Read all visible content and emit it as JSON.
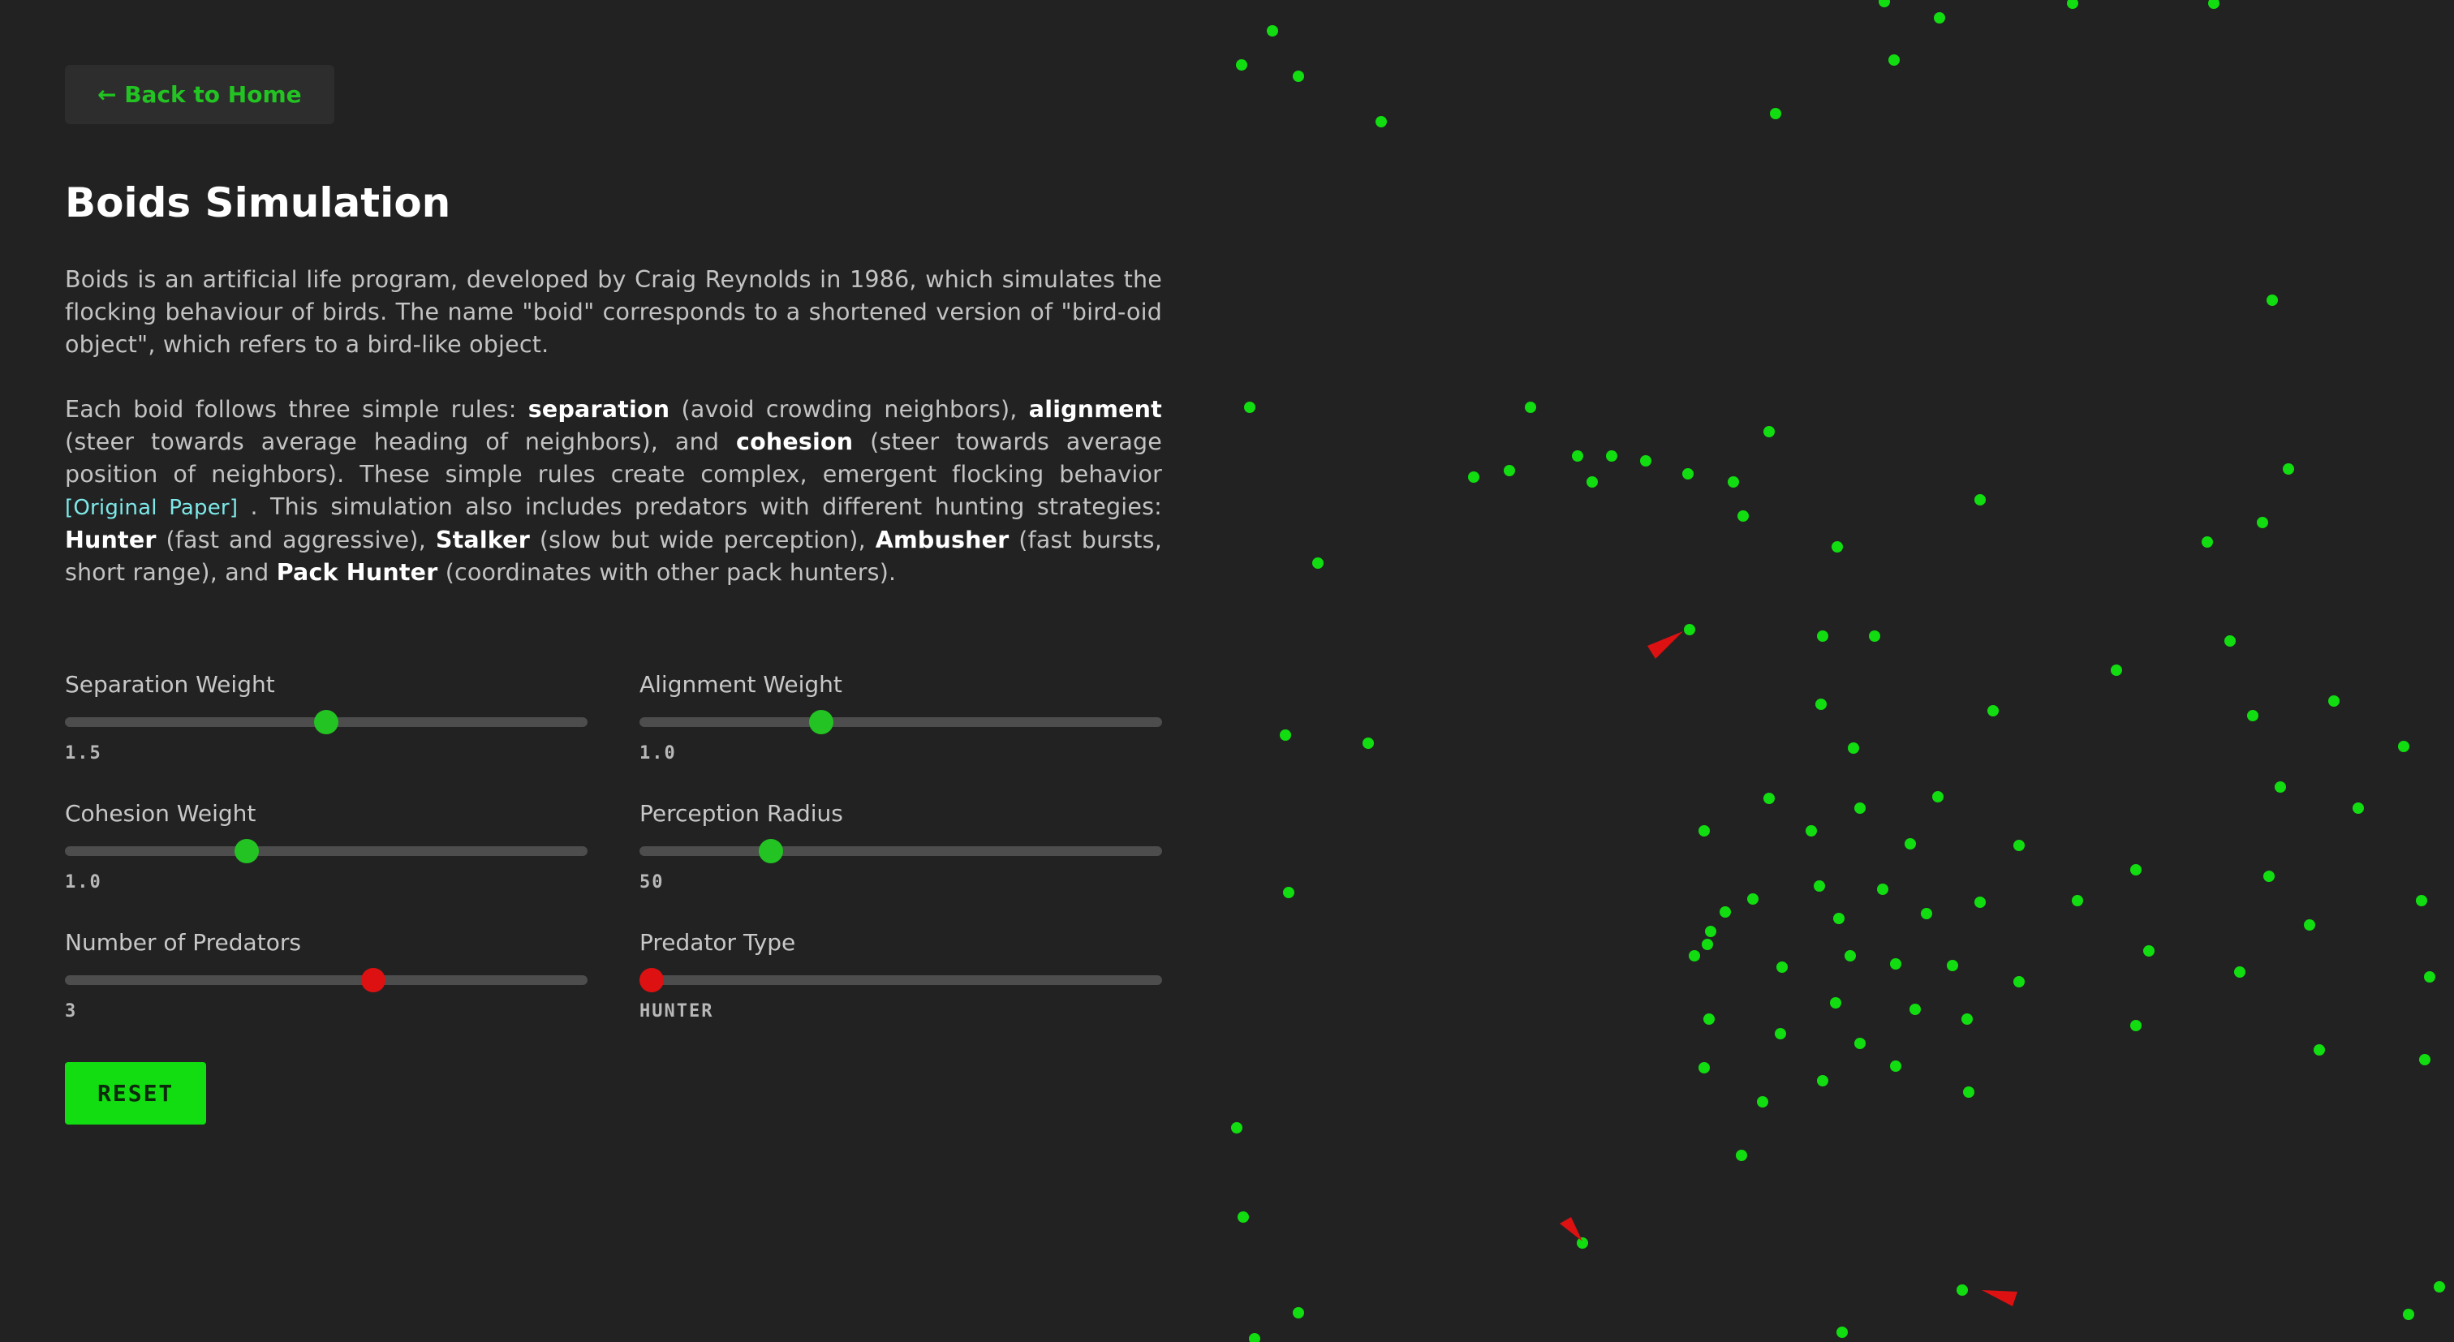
{
  "nav": {
    "back_label": "← Back to Home"
  },
  "page": {
    "title": "Boids Simulation",
    "intro": "Boids is an artificial life program, developed by Craig Reynolds in 1986, which simulates the flocking behaviour of birds. The name \"boid\" corresponds to a shortened version of \"bird-oid object\", which refers to a bird-like object.",
    "rules": {
      "t1": "Each boid follows three simple rules: ",
      "separation": "separation",
      "t2": " (avoid crowding neighbors), ",
      "alignment": "alignment",
      "t3": " (steer towards average heading of neighbors), and ",
      "cohesion": "cohesion",
      "t4": " (steer towards average position of neighbors). These simple rules create complex, emergent flocking behavior ",
      "paper_link": "[Original Paper]",
      "t5": " . This simulation also includes predators with different hunting strategies: ",
      "hunter": "Hunter",
      "t6": " (fast and aggressive), ",
      "stalker": "Stalker",
      "t7": " (slow but wide perception), ",
      "ambusher": "Ambusher",
      "t8": " (fast bursts, short range), and ",
      "pack_hunter": "Pack Hunter",
      "t9": " (coordinates with other pack hunters)."
    }
  },
  "controls": {
    "separation": {
      "label": "Separation Weight",
      "value": "1.5",
      "fraction": 0.5
    },
    "alignment": {
      "label": "Alignment Weight",
      "value": "1.0",
      "fraction": 0.34
    },
    "cohesion": {
      "label": "Cohesion Weight",
      "value": "1.0",
      "fraction": 0.34
    },
    "perception": {
      "label": "Perception Radius",
      "value": "50",
      "fraction": 0.24
    },
    "predators": {
      "label": "Number of Predators",
      "value": "3",
      "fraction": 0.595
    },
    "predator_type": {
      "label": "Predator Type",
      "value": "HUNTER",
      "fraction": 0.0
    },
    "reset_label": "RESET"
  },
  "colors": {
    "accent": "#22c322",
    "boid": "#11dd11",
    "predator": "#dd1111",
    "background": "#222222"
  }
}
